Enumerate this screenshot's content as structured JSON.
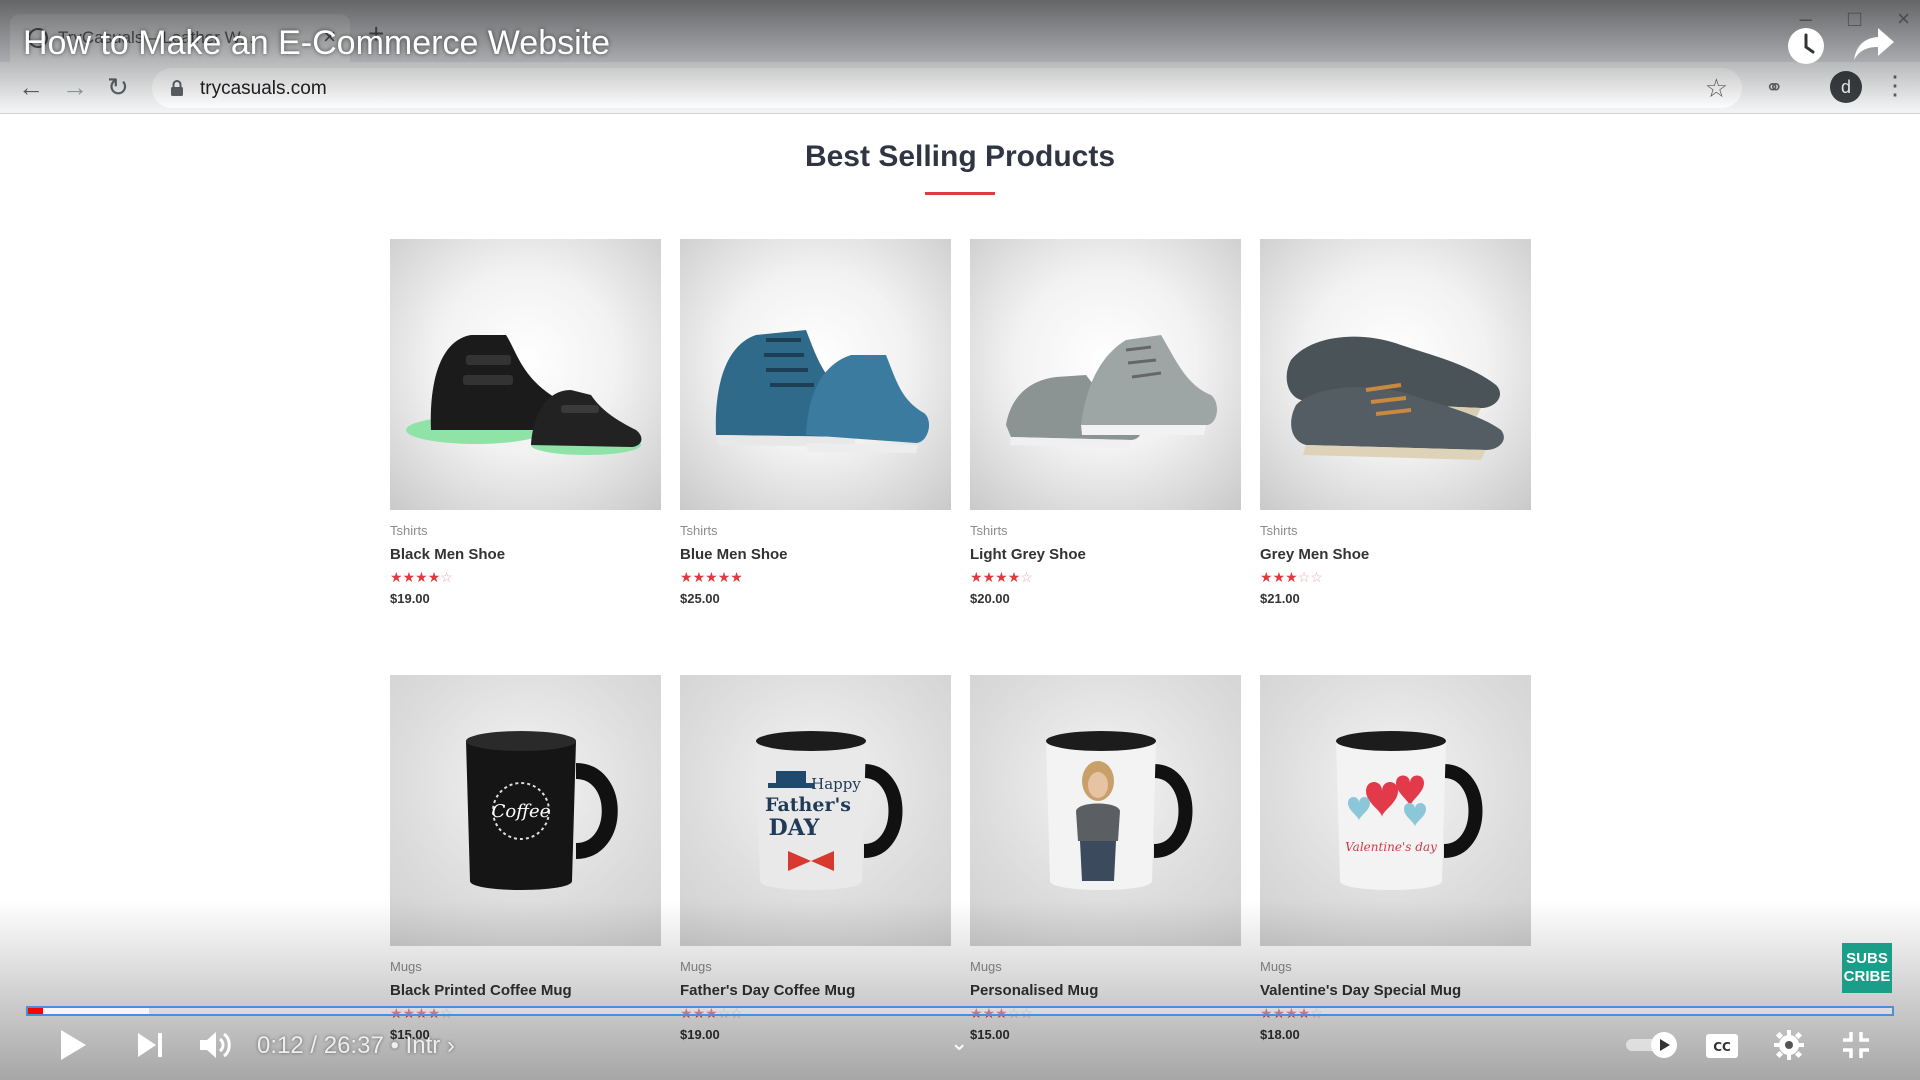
{
  "browser": {
    "tab_title": "TryCasuals – Leather W...",
    "url": "trycasuals.com",
    "profile_initial": "d"
  },
  "video": {
    "title": "How to Make an E-Commerce Website",
    "time_current": "0:12",
    "time_total": "26:37",
    "chapter": "Intr",
    "progress_fraction": 0.008,
    "buffer_fraction": 0.065,
    "subscribe_badge": "SUBS\nCRIBE"
  },
  "page": {
    "section_title": "Best Selling Products",
    "products": [
      {
        "category": "Tshirts",
        "name": "Black Men Shoe",
        "rating": 4,
        "price": "$19.00",
        "kind": "shoe-black"
      },
      {
        "category": "Tshirts",
        "name": "Blue Men Shoe",
        "rating": 5,
        "price": "$25.00",
        "kind": "shoe-blue"
      },
      {
        "category": "Tshirts",
        "name": "Light Grey Shoe",
        "rating": 4,
        "price": "$20.00",
        "kind": "shoe-grey"
      },
      {
        "category": "Tshirts",
        "name": "Grey Men Shoe",
        "rating": 3,
        "price": "$21.00",
        "kind": "shoe-felt"
      },
      {
        "category": "Mugs",
        "name": "Black Printed Coffee Mug",
        "rating": 4,
        "price": "$15.00",
        "kind": "mug-black"
      },
      {
        "category": "Mugs",
        "name": "Father's Day Coffee Mug",
        "rating": 3,
        "price": "$19.00",
        "kind": "mug-father"
      },
      {
        "category": "Mugs",
        "name": "Personalised Mug",
        "rating": 3,
        "price": "$15.00",
        "kind": "mug-photo"
      },
      {
        "category": "Mugs",
        "name": "Valentine's Day Special Mug",
        "rating": 4,
        "price": "$18.00",
        "kind": "mug-hearts"
      }
    ],
    "mug_texts": {
      "coffee": "Coffee",
      "father_line1": "Happy",
      "father_line2": "Father's",
      "father_line3": "DAY",
      "valentine": "Valentine's day"
    }
  },
  "colors": {
    "accent_red": "#e0393e",
    "heading": "#2f3542",
    "progress_red": "#ff0000",
    "subscribe_teal": "#1a9e8a"
  }
}
